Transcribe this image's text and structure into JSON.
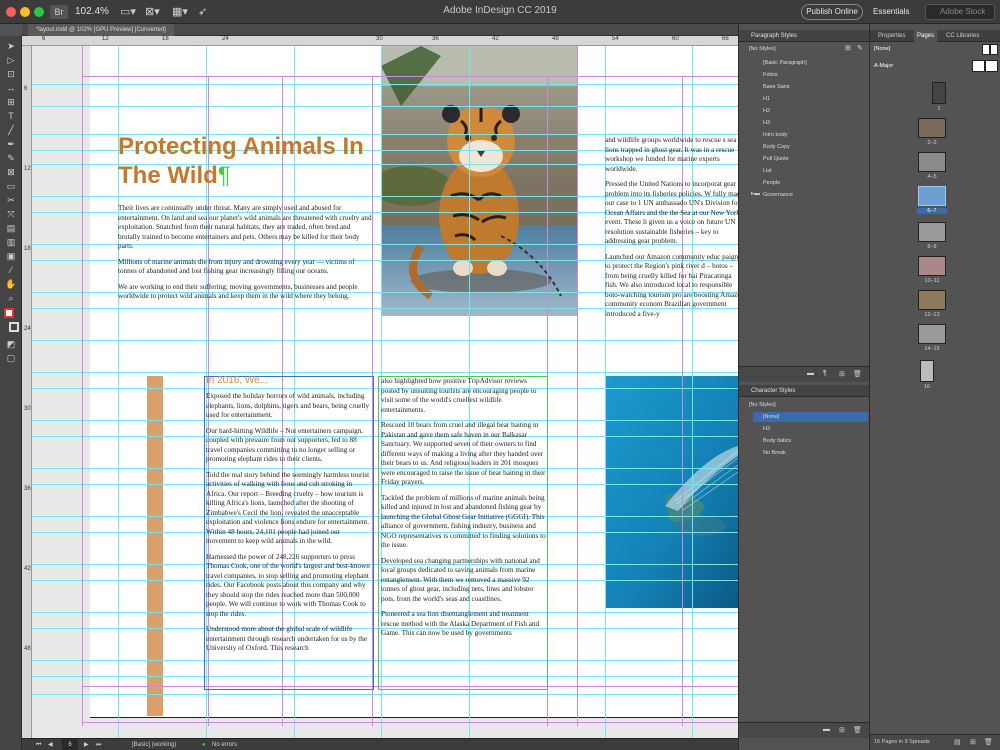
{
  "titlebar": {
    "zoom": "102.4%",
    "app_title": "Adobe InDesign CC 2019",
    "publish_label": "Publish Online",
    "workspace_label": "Essentials",
    "search_placeholder": "Adobe Stock"
  },
  "doc_tab": {
    "label": "*layout.indd @ 102% [GPU Preview] [Converted]"
  },
  "ruler_marks": [
    "6",
    "12",
    "18",
    "24",
    "30",
    "36",
    "42",
    "48",
    "54",
    "60",
    "66"
  ],
  "vruler_marks": [
    "6",
    "12",
    "18",
    "24",
    "30",
    "36",
    "42",
    "48"
  ],
  "article": {
    "headline_1": "Protecting Animals In",
    "headline_2": "The Wild",
    "pilcrow": "¶",
    "col1": [
      "Their lives are continually under threat. Many are simply used and abused for entertainment. On land and sea our planet's wild animals are threatened with cruelty and exploitation. Snatched from their natural habitats, they are traded, often bred and brutally trained to become entertainers and pets. Others may be killed for their body parts.",
      "Millions of marine animals die from injury and drowning every year — victims of tonnes of abandoned and lost fishing gear increasingly filling our oceans.",
      "We are working to end their suffering; moving governments, businesses and people worldwide to protect wild animals and keep them in the wild where they belong."
    ],
    "subhead": "In 2016, We...",
    "col2": [
      "Exposed the holiday horrors of wild animals, including elephants, lions, dolphins, tigers and bears, being cruelly used for entertainment.",
      "Our hard-hitting Wildlife – Not entertainers campaign, coupled with pressure from our supporters, led to 88 travel companies committing to no longer selling or promoting elephant rides to their clients.",
      "Told the real story behind the seemingly harmless tourist activities of walking with lions and cub stroking in Africa. Our report – Breeding cruelty – how tourism is killing Africa's lions, launched after the shooting of Zimbabwe's Cecil the lion, revealed the unacceptable exploitation and violence lions endure for entertainment. Within 48 hours, 24,101 people had joined our movement to keep wild animals in the wild.",
      "Harnessed the power of 248,226 supporters to press Thomas Cook, one of the world's largest and best-known travel companies, to stop selling and promoting elephant rides. Our Facebook posts about this company and why they should stop the rides reached more than 500,000 people. We will continue to work with Thomas Cook to stop the rides.",
      "Understood more about the global scale of wildlife entertainment through research undertaken for us by the University of Oxford. This research"
    ],
    "col3": [
      "also highlighted how positive TripAdvisor reviews posted by unsuiting tourists are encouraging people to visit some of the world's cruellest wildlife entertainments.",
      "Rescued 10 bears from cruel and illegal bear baiting in Pakistan and gave them safe haven in our Balkasar Sanctuary. We supported seven of their owners to find different ways of making a living after they handed over their bears to us. And religious leaders in 201 mosques were encouraged to raise the issue of bear baiting in their Friday prayers.",
      "Tackled the problem of millions of marine animals being killed and injured in lost and abandoned fishing gear by launching the Global Ghost Gear Initiative (GGGI). This alliance of government, fishing industry, business and NGO representatives is committed to finding solutions to the issue.",
      "Developed sea changing partnerships with national and local groups dedicated to saving animals from marine entanglement. With them we removed a massive 92 tonnes of ghost gear, including nets, lines and lobster pots, from the world's seas and coastlines.",
      "Pioneered a sea lion disentanglement and treatment rescue method with the Alaska Department of Fish and Game. This can now be used by governments"
    ],
    "col4": [
      "and wildlife groups worldwide to rescue s sea lions trapped in ghost gear. It was in a rescue workshop we funded for marine experts worldwide.",
      "Pressed the United Nations to incorporat gear problem into its fisheries policies. W fully made our case to 1 UN ambassado UN's Division for Ocean Affairs and the the Sea at our New York event. These li given us a voice on future UN resolution sustainable fisheries – key to addressing gear problem.",
      "Launched our Amazon community educ paign to protect the Region's pink river d – botos – from being cruelly killed for bai Piracatinga fish. We also introduced local to responsible boto-watching tourism pro are boosting Amazon community econom Brazilian government introduced a five-y"
    ]
  },
  "paragraph_styles": {
    "title": "Paragraph Styles",
    "current": "[No Styles]",
    "items": [
      "[Basic Paragraph]",
      "Folios",
      "Base Sans",
      "H1",
      "H2",
      "H3",
      "Intro body",
      "Body Copy",
      "Pull Quote",
      "List",
      "People",
      "Governance"
    ]
  },
  "character_styles": {
    "title": "Character Styles",
    "current": "[No Styles]",
    "items": [
      "[None]",
      "H3",
      "Body Italics",
      "No Break"
    ]
  },
  "pages_panel": {
    "tabs": [
      "Properties",
      "Pages",
      "CC Libraries"
    ],
    "none_label": "[None]",
    "master_label": "A-Major",
    "page_labels": [
      "1",
      "2–3",
      "4–5",
      "6–7",
      "8–9",
      "10–11",
      "12–13",
      "14–15",
      "16"
    ],
    "footer": "16 Pages in 9 Spreads"
  },
  "statusbar": {
    "page": "6",
    "style": "[Basic] (working)",
    "errors": "No errors"
  },
  "colors": {
    "accent_orange": "#c5772a",
    "guide_cyan": "#7be3ee",
    "margin_violet": "#c98be0"
  }
}
